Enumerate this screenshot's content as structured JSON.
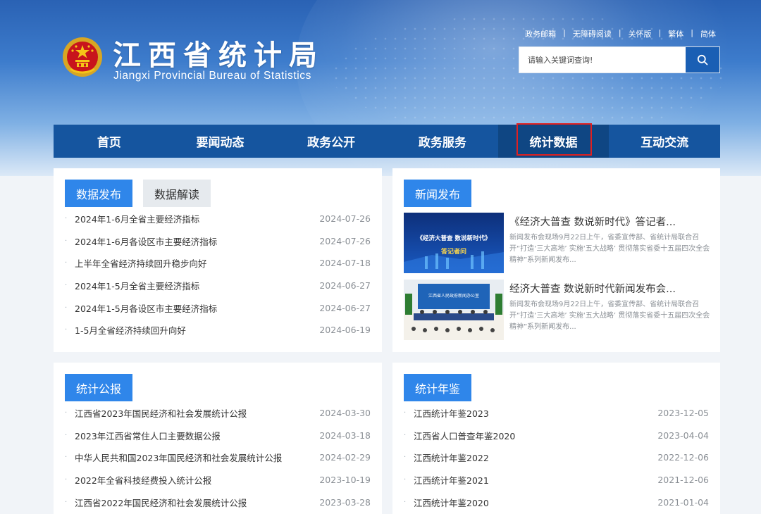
{
  "header": {
    "title": "江西省统计局",
    "subtitle": "Jiangxi Provincial Bureau of Statistics",
    "top_links": [
      "政务邮箱",
      "无障碍阅读",
      "关怀版",
      "繁体",
      "简体"
    ],
    "search_placeholder": "请输入关键词查询!"
  },
  "nav": {
    "items": [
      "首页",
      "要闻动态",
      "政务公开",
      "政务服务",
      "统计数据",
      "互动交流"
    ],
    "active_index": 4
  },
  "data_release": {
    "tabs": [
      "数据发布",
      "数据解读"
    ],
    "items": [
      {
        "title": "2024年1-6月全省主要经济指标",
        "date": "2024-07-26"
      },
      {
        "title": "2024年1-6月各设区市主要经济指标",
        "date": "2024-07-26"
      },
      {
        "title": "上半年全省经济持续回升稳步向好",
        "date": "2024-07-18"
      },
      {
        "title": "2024年1-5月全省主要经济指标",
        "date": "2024-06-27"
      },
      {
        "title": "2024年1-5月各设区市主要经济指标",
        "date": "2024-06-27"
      },
      {
        "title": "1-5月全省经济持续回升向好",
        "date": "2024-06-19"
      }
    ]
  },
  "news": {
    "tab": "新闻发布",
    "items": [
      {
        "title": "《经济大普查 数说新时代》答记者...",
        "desc": "新闻发布会现场9月22日上午，省委宣传部、省统计局联合召开“打造‘三大高地’ 实施‘五大战略’ 贯彻落实省委十五届四次全会精神”系列新闻发布...",
        "img_line1": "《经济大普查 数说新时代》",
        "img_line2": "答记者问"
      },
      {
        "title": "经济大普查 数说新时代新闻发布会...",
        "desc": "新闻发布会现场9月22日上午，省委宣传部、省统计局联合召开“打造‘三大高地’ 实施‘五大战略’ 贯彻落实省委十五届四次全会精神”系列新闻发布...",
        "img_line1": "江西省人民政府新闻办公室"
      }
    ]
  },
  "bulletin": {
    "tab": "统计公报",
    "items": [
      {
        "title": "江西省2023年国民经济和社会发展统计公报",
        "date": "2024-03-30"
      },
      {
        "title": "2023年江西省常住人口主要数据公报",
        "date": "2024-03-18"
      },
      {
        "title": "中华人民共和国2023年国民经济和社会发展统计公报",
        "date": "2024-02-29"
      },
      {
        "title": "2022年全省科技经费投入统计公报",
        "date": "2023-10-19"
      },
      {
        "title": "江西省2022年国民经济和社会发展统计公报",
        "date": "2023-03-28"
      }
    ]
  },
  "yearbook": {
    "tab": "统计年鉴",
    "items": [
      {
        "title": "江西统计年鉴2023",
        "date": "2023-12-05"
      },
      {
        "title": "江西省人口普查年鉴2020",
        "date": "2023-04-04"
      },
      {
        "title": "江西统计年鉴2022",
        "date": "2022-12-06"
      },
      {
        "title": "江西统计年鉴2021",
        "date": "2021-12-06"
      },
      {
        "title": "江西统计年鉴2020",
        "date": "2021-01-04"
      }
    ]
  },
  "colors": {
    "nav_bg": "#15559f",
    "tab_active": "#2f86ea",
    "highlight_border": "#e02020"
  }
}
